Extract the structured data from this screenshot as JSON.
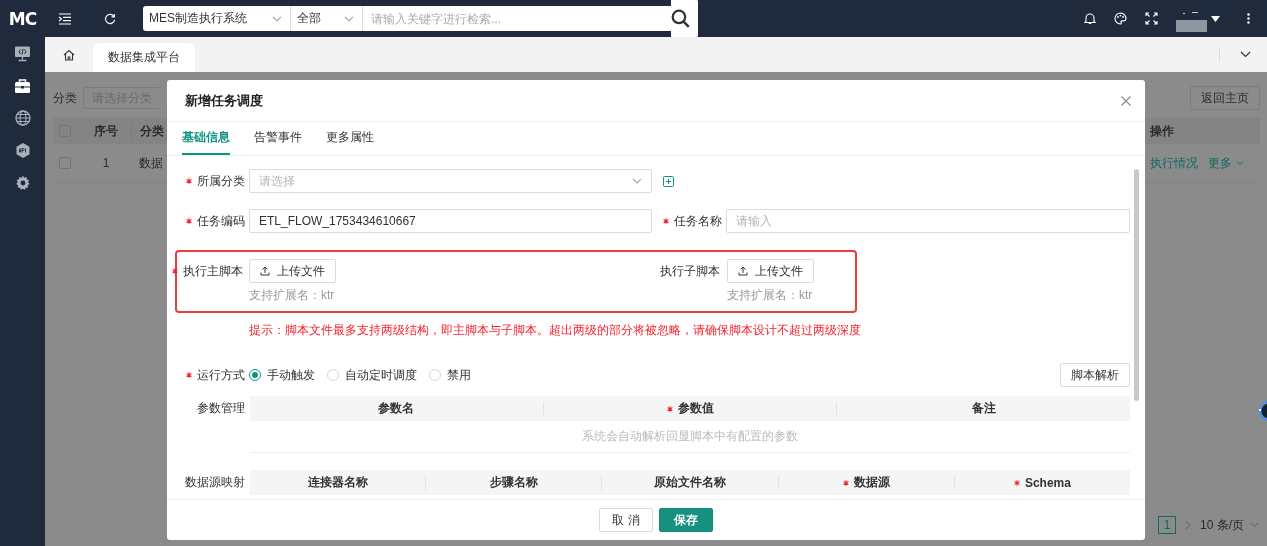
{
  "topbar": {
    "logo": "MC",
    "system_select": {
      "value": "MES制造执行系统"
    },
    "scope_select": {
      "value": "全部"
    },
    "search": {
      "placeholder": "请输入关键字进行检索..."
    }
  },
  "sidebar": {
    "items": [
      {
        "kind": "monitor",
        "selected": false
      },
      {
        "kind": "briefcase",
        "selected": true
      },
      {
        "kind": "globe",
        "selected": false
      },
      {
        "kind": "api",
        "selected": false
      },
      {
        "kind": "gear",
        "selected": false
      }
    ]
  },
  "tabs": [
    {
      "label": "数据集成平台",
      "selected": true
    }
  ],
  "page": {
    "filter": {
      "label": "分类",
      "placeholder": "请选择分类"
    },
    "back_button": "返回主页",
    "table": {
      "select_all_checked": false,
      "columns": [
        "序号",
        "分类",
        "操作"
      ],
      "rows": [
        {
          "checked": false,
          "cells": [
            "1",
            "数据"
          ],
          "actions": [
            "执行情况",
            "更多"
          ]
        }
      ]
    },
    "pagination": {
      "pages": [
        {
          "label": "1",
          "selected": true
        }
      ],
      "page_size": "10 条/页"
    }
  },
  "dialog": {
    "title": "新增任务调度",
    "tabs": [
      {
        "label": "基础信息",
        "selected": true
      },
      {
        "label": "告警事件",
        "selected": false
      },
      {
        "label": "更多属性",
        "selected": false
      }
    ],
    "category": {
      "label": "所属分类",
      "required": true,
      "placeholder": "请选择"
    },
    "code": {
      "label": "任务编码",
      "required": true,
      "value": "ETL_FLOW_1753434610667"
    },
    "name": {
      "label": "任务名称",
      "required": true,
      "placeholder": "请输入"
    },
    "scripts": [
      {
        "label": "执行主脚本",
        "required": true,
        "button": "上传文件",
        "hint": "支持扩展名：ktr"
      },
      {
        "label": "执行子脚本",
        "required": false,
        "button": "上传文件",
        "hint": "支持扩展名：ktr"
      }
    ],
    "notice": "提示：脚本文件最多支持两级结构，即主脚本与子脚本。超出两级的部分将被忽略，请确保脚本设计不超过两级深度",
    "run_mode": {
      "label": "运行方式",
      "required": true,
      "options": [
        {
          "label": "手动触发",
          "selected": true
        },
        {
          "label": "自动定时调度",
          "selected": false
        },
        {
          "label": "禁用",
          "selected": false
        }
      ]
    },
    "parse_button": "脚本解析",
    "params": {
      "label": "参数管理",
      "columns": [
        {
          "label": "参数名",
          "required": false
        },
        {
          "label": "参数值",
          "required": true
        },
        {
          "label": "备注",
          "required": false
        }
      ],
      "empty": "系统会自动解析回显脚本中有配置的参数"
    },
    "datasource": {
      "label": "数据源映射",
      "columns": [
        {
          "label": "连接器名称",
          "required": false
        },
        {
          "label": "步骤名称",
          "required": false
        },
        {
          "label": "原始文件名称",
          "required": false
        },
        {
          "label": "数据源",
          "required": true
        },
        {
          "label": "Schema",
          "required": true
        }
      ]
    },
    "footer": {
      "cancel": "取 消",
      "save": "保存"
    }
  }
}
